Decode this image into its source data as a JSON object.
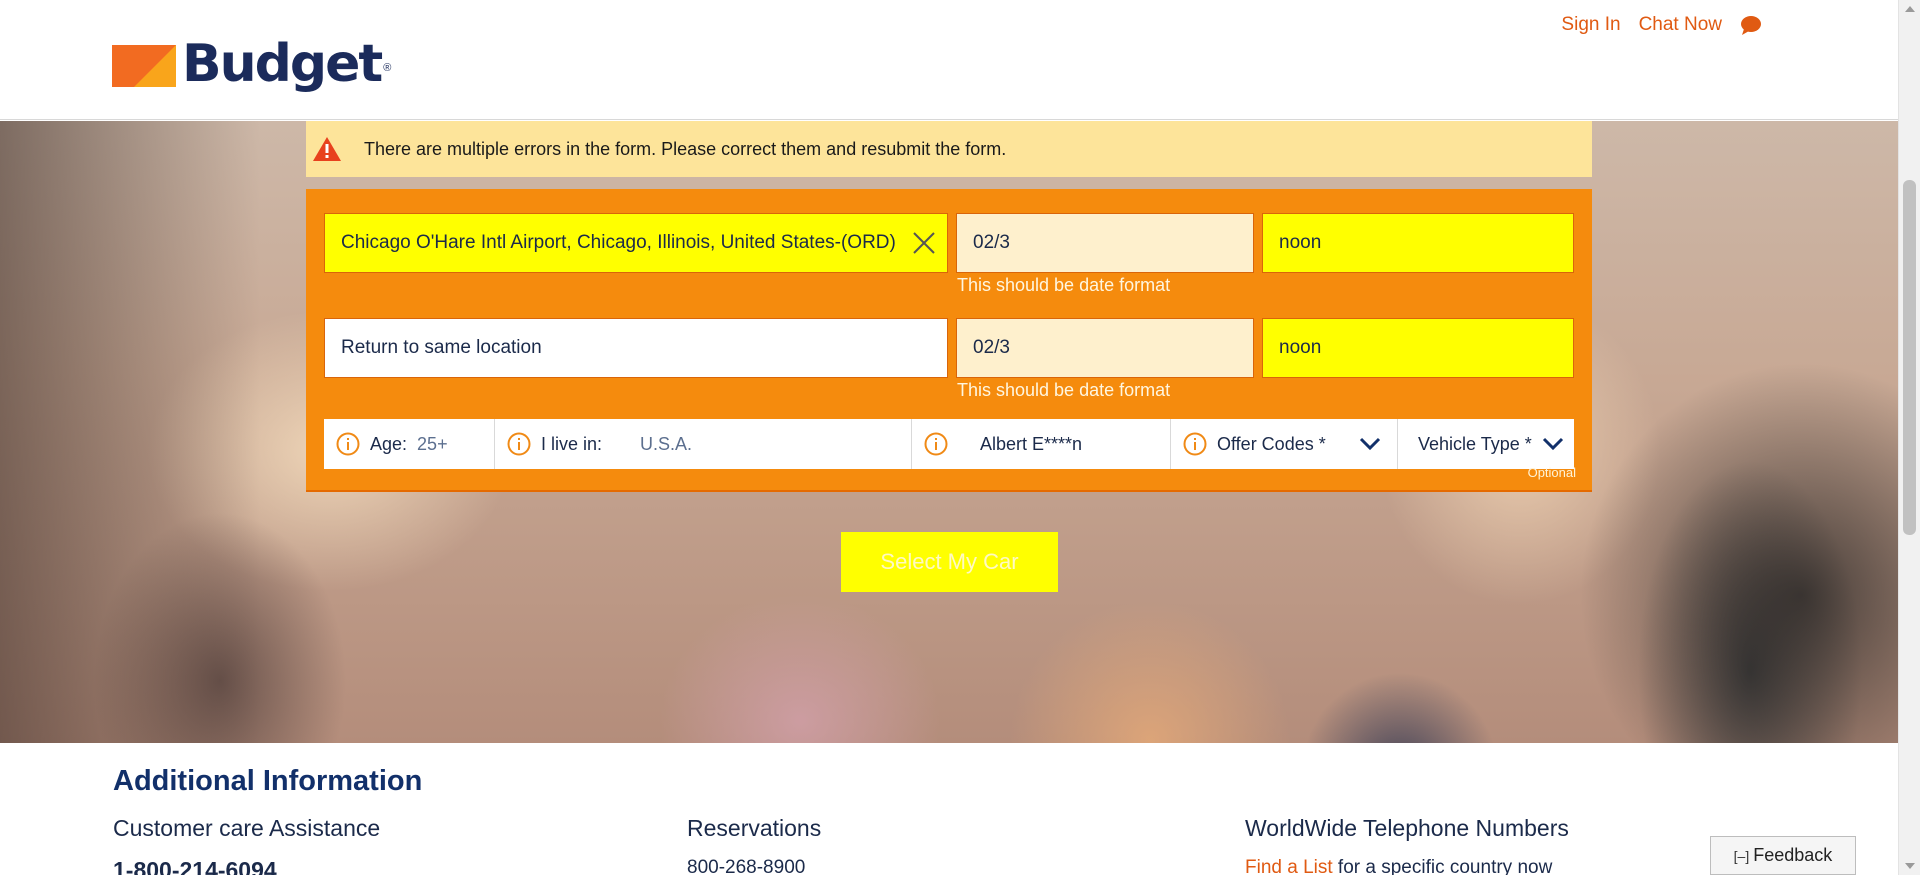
{
  "header": {
    "brand": "Budget",
    "brand_mark": "®",
    "sign_in": "Sign In",
    "chat_now": "Chat Now",
    "chat_icon": "chat-bubble-icon"
  },
  "alert": {
    "icon": "warning-triangle-icon",
    "message": "There are multiple errors in the form. Please correct them and resubmit the form."
  },
  "form": {
    "pickup": {
      "location": "Chicago O'Hare Intl Airport, Chicago, Illinois, United States-(ORD)",
      "date": "02/3",
      "time": "noon",
      "date_error": "This should be date format"
    },
    "return": {
      "location": "Return to same location",
      "date": "02/3",
      "time": "noon",
      "date_error": "This should be date format"
    },
    "options": {
      "age_label": "Age:",
      "age_value": "25+",
      "residence_label": "I live in:",
      "residence_value": "U.S.A.",
      "member_value": "Albert E****n",
      "offer_codes": "Offer Codes *",
      "vehicle_type": "Vehicle Type *",
      "optional_note": "Optional"
    },
    "submit": "Select My Car"
  },
  "additional_info": {
    "title": "Additional Information",
    "customer_care": {
      "title": "Customer care Assistance",
      "phone": "1-800-214-6094"
    },
    "reservations": {
      "title": "Reservations",
      "phone": "800-268-8900"
    },
    "worldwide": {
      "title": "WorldWide Telephone Numbers",
      "link": "Find a List",
      "suffix": " for a specific country now"
    }
  },
  "feedback": {
    "bracket": "[–]",
    "label": "Feedback"
  },
  "colors": {
    "brand_orange": "#f26b21",
    "form_orange": "#f58b0d",
    "error_yellow": "#ffff00",
    "alert_bg": "#fde49a",
    "navy": "#12306a"
  }
}
